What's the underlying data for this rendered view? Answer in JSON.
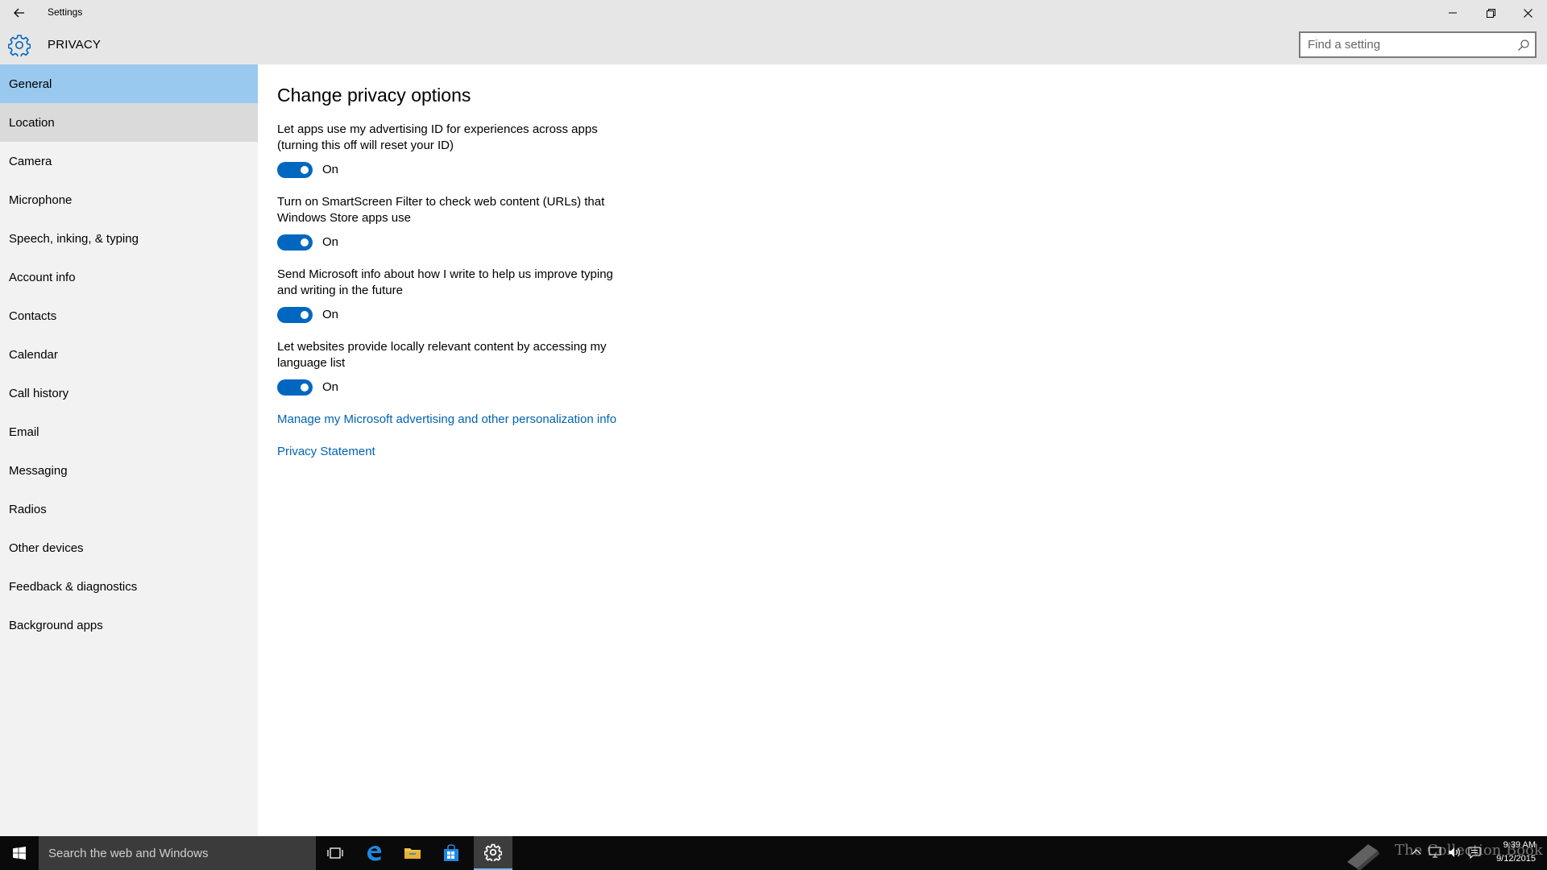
{
  "window": {
    "title": "Settings",
    "section": "PRIVACY",
    "search_placeholder": "Find a setting"
  },
  "sidebar": {
    "items": [
      {
        "label": "General",
        "state": "selected"
      },
      {
        "label": "Location",
        "state": "hover"
      },
      {
        "label": "Camera",
        "state": ""
      },
      {
        "label": "Microphone",
        "state": ""
      },
      {
        "label": "Speech, inking, & typing",
        "state": ""
      },
      {
        "label": "Account info",
        "state": ""
      },
      {
        "label": "Contacts",
        "state": ""
      },
      {
        "label": "Calendar",
        "state": ""
      },
      {
        "label": "Call history",
        "state": ""
      },
      {
        "label": "Email",
        "state": ""
      },
      {
        "label": "Messaging",
        "state": ""
      },
      {
        "label": "Radios",
        "state": ""
      },
      {
        "label": "Other devices",
        "state": ""
      },
      {
        "label": "Feedback & diagnostics",
        "state": ""
      },
      {
        "label": "Background apps",
        "state": ""
      }
    ]
  },
  "main": {
    "heading": "Change privacy options",
    "options": [
      {
        "desc": "Let apps use my advertising ID for experiences across apps (turning this off will reset your ID)",
        "state": "On"
      },
      {
        "desc": "Turn on SmartScreen Filter to check web content (URLs) that Windows Store apps use",
        "state": "On"
      },
      {
        "desc": "Send Microsoft info about how I write to help us improve typing and writing in the future",
        "state": "On"
      },
      {
        "desc": "Let websites provide locally relevant content by accessing my language list",
        "state": "On"
      }
    ],
    "links": {
      "manage": "Manage my Microsoft advertising and other personalization info",
      "privacy": "Privacy Statement"
    }
  },
  "taskbar": {
    "search_placeholder": "Search the web and Windows",
    "time": "9:39 AM",
    "date": "9/12/2015",
    "watermark": "The Collection Book"
  },
  "colors": {
    "accent": "#0067c0",
    "selected_nav": "#99c9ef",
    "link": "#0063b1"
  }
}
